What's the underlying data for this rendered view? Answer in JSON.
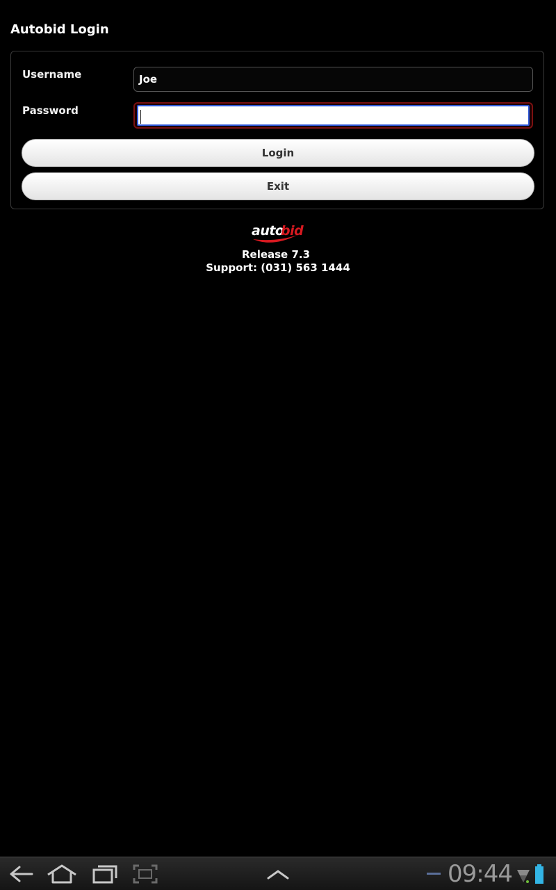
{
  "header": {
    "title": "Autobid Login"
  },
  "form": {
    "username_label": "Username",
    "username_value": "Joe",
    "password_label": "Password",
    "password_value": "",
    "login_label": "Login",
    "exit_label": "Exit"
  },
  "footer": {
    "logo_text": "autobid",
    "release": "Release 7.3",
    "support": "Support: (031) 563 1444"
  },
  "system_bar": {
    "time": "09:44",
    "icons": [
      "back-icon",
      "home-icon",
      "recent-apps-icon",
      "screenshot-icon",
      "chevron-up-icon",
      "notification-dash-icon",
      "wifi-icon",
      "battery-icon"
    ]
  },
  "colors": {
    "background": "#000000",
    "logo_red": "#d71920",
    "focus_blue": "#2d57d6",
    "focus_glow": "#7a1010"
  }
}
